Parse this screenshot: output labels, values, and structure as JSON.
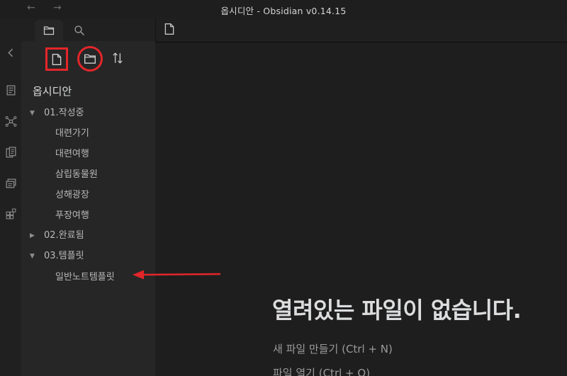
{
  "window": {
    "title": "옵시디안 - Obsidian v0.14.15",
    "back_icon": "←",
    "forward_icon": "→"
  },
  "ribbon": {
    "icons": [
      "collapse-chevron-icon",
      "switcher-icon",
      "graph-icon",
      "templates-icon",
      "slides-icon",
      "starter-icon"
    ]
  },
  "sidebar": {
    "tabs": [
      "files-folder-icon",
      "search-icon"
    ],
    "actions": [
      "new-note-icon",
      "new-folder-icon",
      "sort-icon"
    ],
    "vault_name": "옵시디안",
    "tree": {
      "folder1": {
        "caret": "▼",
        "label": "01.작성중"
      },
      "folder1_files": [
        "대련가기",
        "대련여행",
        "삼립동물원",
        "성해광장",
        "푸장여행"
      ],
      "folder2": {
        "caret": "▶",
        "label": "02.완료됨"
      },
      "folder3": {
        "caret": "▼",
        "label": "03.템플릿"
      },
      "folder3_files": [
        "일반노트템플릿"
      ]
    }
  },
  "main": {
    "tab_icon": "document-icon",
    "empty_title": "열려있는 파일이 없습니다.",
    "actions": [
      "새 파일 만들기 (Ctrl + N)",
      "파일 열기 (Ctrl + O)"
    ]
  },
  "annotation_color": "#e3262a"
}
